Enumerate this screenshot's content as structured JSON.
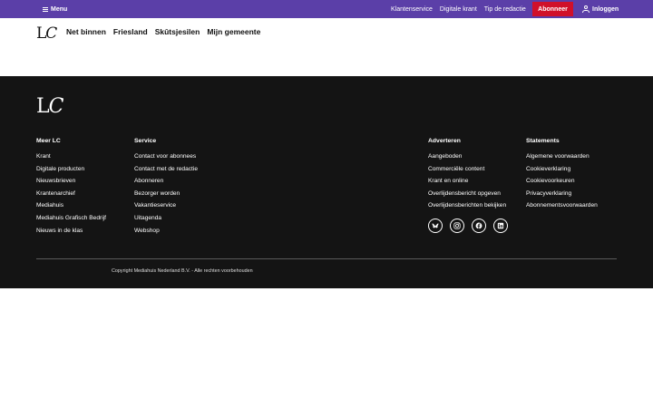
{
  "topbar": {
    "menu_label": "Menu",
    "links": [
      "Klantenservice",
      "Digitale krant",
      "Tip de redactie"
    ],
    "subscribe_label": "Abonneer",
    "login_label": "Inloggen",
    "bg_color": "#5b3fa8",
    "subscribe_color": "#d0102a"
  },
  "brand": {
    "logo_l": "L",
    "logo_c": "C"
  },
  "nav": {
    "items": [
      "Net binnen",
      "Friesland",
      "Skûtsjesilen",
      "Mijn gemeente"
    ]
  },
  "footer": {
    "bg_color": "#141414",
    "columns": [
      {
        "title": "Meer LC",
        "items": [
          "Krant",
          "Digitale producten",
          "Nieuwsbrieven",
          "Krantenarchief",
          "Mediahuis",
          "Mediahuis Grafisch Bedrijf",
          "Nieuws in de klas"
        ]
      },
      {
        "title": "Service",
        "items": [
          "Contact voor abonnees",
          "Contact met de redactie",
          "Abonneren",
          "Bezorger worden",
          "Vakantieservice",
          "Uitagenda",
          "Webshop"
        ]
      },
      {
        "title": "Adverteren",
        "items": [
          "Aangeboden",
          "Commerciële content",
          "Krant en online",
          "Overlijdensbericht opgeven",
          "Overlijdensberichten bekijken"
        ]
      },
      {
        "title": "Statements",
        "items": [
          "Algemene voorwaarden",
          "Cookieverklaring",
          "Cookievoorkeuren",
          "Privacyverklaring",
          "Abonnementsvoorwaarden"
        ]
      }
    ],
    "social": [
      "bluesky-icon",
      "instagram-icon",
      "facebook-icon",
      "linkedin-icon"
    ],
    "copyright": "Copyright Mediahuis Nederland B.V. - Alle rechten voorbehouden"
  }
}
